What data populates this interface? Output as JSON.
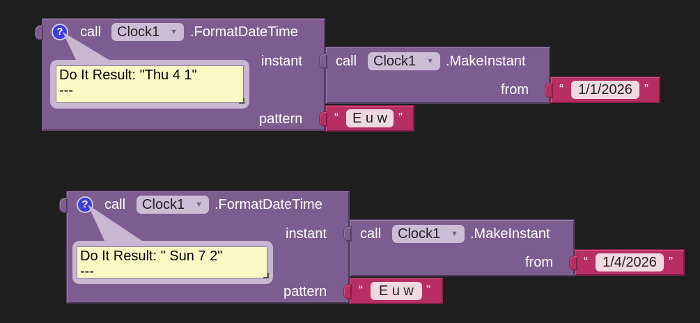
{
  "colors": {
    "background": "#1e1e1e",
    "procedure_block": "#7d5d8f",
    "text_block": "#b72f62",
    "result_bubble": "#fbf8c4",
    "help_icon": "#3d3dd8"
  },
  "blocks": [
    {
      "help_icon": "?",
      "call_label": "call",
      "component": "Clock1",
      "method": ".FormatDateTime",
      "result_text": "Do It Result: \"Thu 4 1\"\n---",
      "instant_label": "instant",
      "pattern_label": "pattern",
      "instant_block": {
        "call_label": "call",
        "component": "Clock1",
        "method": ".MakeInstant",
        "from_label": "from",
        "from_value": "1/1/2026"
      },
      "pattern_value": "E u w"
    },
    {
      "help_icon": "?",
      "call_label": "call",
      "component": "Clock1",
      "method": ".FormatDateTime",
      "result_text": "Do It Result: \" Sun 7 2\"\n---",
      "instant_label": "instant",
      "pattern_label": "pattern",
      "instant_block": {
        "call_label": "call",
        "component": "Clock1",
        "method": ".MakeInstant",
        "from_label": "from",
        "from_value": "1/4/2026"
      },
      "pattern_value": "E u w"
    }
  ],
  "quote_open": "“",
  "quote_close": "”",
  "dropdown_arrow": "▼"
}
